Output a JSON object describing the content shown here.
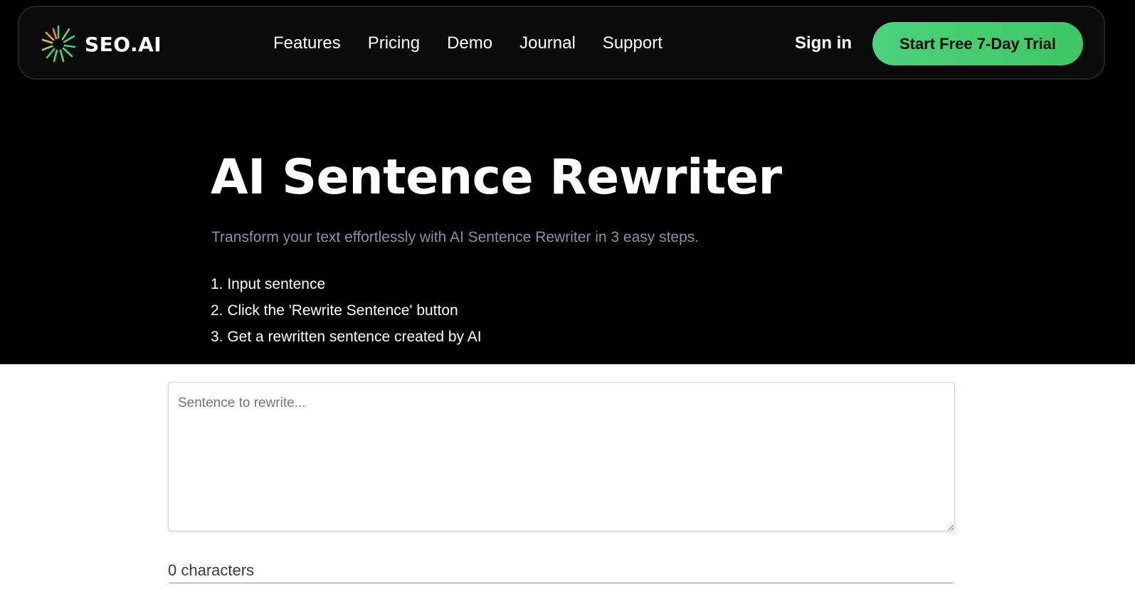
{
  "brand": {
    "name": "SEO.AI",
    "accent_color": "#3ec765"
  },
  "nav": {
    "links": [
      "Features",
      "Pricing",
      "Demo",
      "Journal",
      "Support"
    ],
    "sign_in": "Sign in",
    "cta": "Start Free 7-Day Trial"
  },
  "hero": {
    "title": "AI Sentence Rewriter",
    "subtitle": "Transform your text effortlessly with AI Sentence Rewriter in 3 easy steps.",
    "steps": [
      "1. Input sentence",
      "2. Click the 'Rewrite Sentence' button",
      "3. Get a rewritten sentence created by AI"
    ]
  },
  "tool": {
    "input_value": "",
    "input_placeholder": "Sentence to rewrite...",
    "char_count": "0 characters"
  },
  "icons": {
    "logo": "sunburst-logo-icon"
  }
}
